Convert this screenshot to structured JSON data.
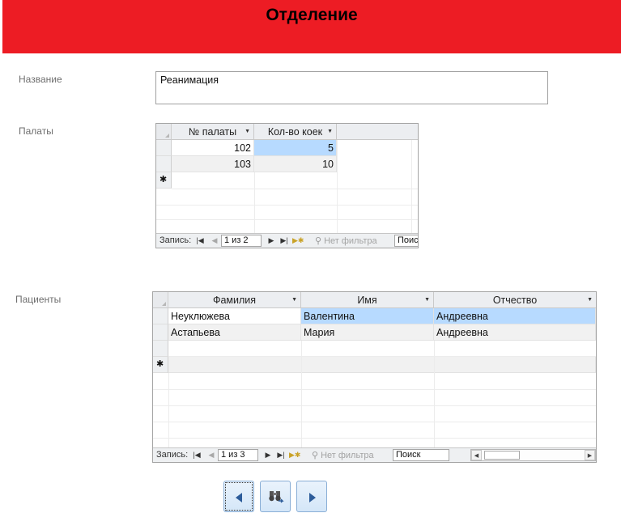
{
  "form": {
    "title": "Отделение"
  },
  "name_field": {
    "label": "Название",
    "value": "Реанимация"
  },
  "wards": {
    "label": "Палаты",
    "columns": [
      "№ палаты",
      "Кол-во коек"
    ],
    "rows": [
      {
        "number": "102",
        "beds": "5"
      },
      {
        "number": "103",
        "beds": "10"
      }
    ],
    "nav": {
      "label": "Запись:",
      "position": "1 из 2",
      "filter": "Нет фильтра",
      "search": "Поис"
    }
  },
  "patients": {
    "label": "Пациенты",
    "columns": [
      "Фамилия",
      "Имя",
      "Отчество"
    ],
    "rows": [
      {
        "last": "Неуклюжева",
        "first": "Валентина",
        "middle": "Андреевна"
      },
      {
        "last": "Астапьева",
        "first": "Мария",
        "middle": "Андреевна"
      }
    ],
    "nav": {
      "label": "Запись:",
      "position": "1 из 3",
      "filter": "Нет фильтра",
      "search": "Поиск"
    }
  },
  "buttons": {
    "prev_icon": "triangle-left-icon",
    "find_icon": "binoculars-icon",
    "next_icon": "triangle-right-icon"
  },
  "colors": {
    "header": "#ed1c24",
    "selection": "#b7daff",
    "button": "#d4e6f8"
  }
}
